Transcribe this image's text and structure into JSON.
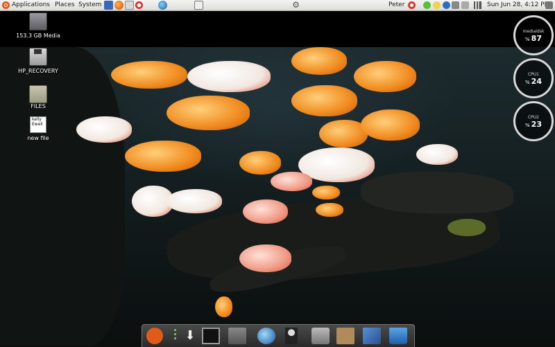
{
  "panel": {
    "menus": [
      "Applications",
      "Places",
      "System"
    ],
    "user": "Peter",
    "clock": "Sun Jun 28,  4:12 PM"
  },
  "desktop_icons": [
    {
      "label": "153.3 GB Media",
      "icon": "drive-icon"
    },
    {
      "label": "HP_RECOVERY",
      "icon": "floppy-icon"
    },
    {
      "label": "FILES",
      "icon": "folder-icon"
    },
    {
      "label": "new file",
      "icon": "text-file-icon",
      "preview": [
        "kelly",
        "Eweli"
      ]
    }
  ],
  "gauges": [
    {
      "name": "mediaIdsk",
      "unit": "%",
      "value": "87"
    },
    {
      "name": "CPU1",
      "unit": "%",
      "value": "24"
    },
    {
      "name": "CPU2",
      "unit": "%",
      "value": "23"
    }
  ],
  "dock_items": [
    "ubuntu-icon",
    "download-icon",
    "terminal-icon",
    "drive-icon",
    "globe-icon",
    "user-icon",
    "window-icon",
    "archive-icon",
    "documents-icon",
    "trash-icon"
  ],
  "colors": {
    "accent": "#e05a1a",
    "dock": "#3a3a3a"
  }
}
